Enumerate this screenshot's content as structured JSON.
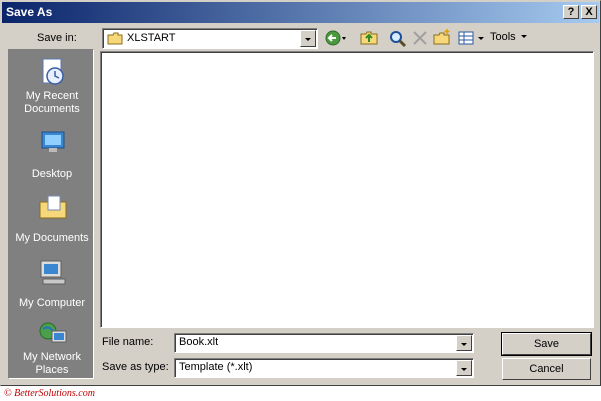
{
  "window": {
    "title": "Save As"
  },
  "title_buttons": {
    "help": "?",
    "close": "X"
  },
  "save_in": {
    "label": "Save in:",
    "folder": "XLSTART"
  },
  "toolbar": {
    "tools_label": "Tools"
  },
  "places": [
    {
      "label": "My Recent\nDocuments",
      "icon": "recent-documents-icon"
    },
    {
      "label": "Desktop",
      "icon": "desktop-icon"
    },
    {
      "label": "My Documents",
      "icon": "my-documents-icon"
    },
    {
      "label": "My Computer",
      "icon": "my-computer-icon"
    },
    {
      "label": "My Network\nPlaces",
      "icon": "network-places-icon"
    }
  ],
  "file_name": {
    "label": "File name:",
    "value": "Book.xlt"
  },
  "save_as_type": {
    "label": "Save as type:",
    "value": "Template (*.xlt)"
  },
  "buttons": {
    "save": "Save",
    "cancel": "Cancel"
  },
  "footer": "© BetterSolutions.com",
  "colors": {
    "title_start": "#0a246a",
    "title_end": "#a6caf0",
    "dialog_bg": "#d4d0c8",
    "places_bg": "#808080",
    "footer": "#c00000"
  }
}
